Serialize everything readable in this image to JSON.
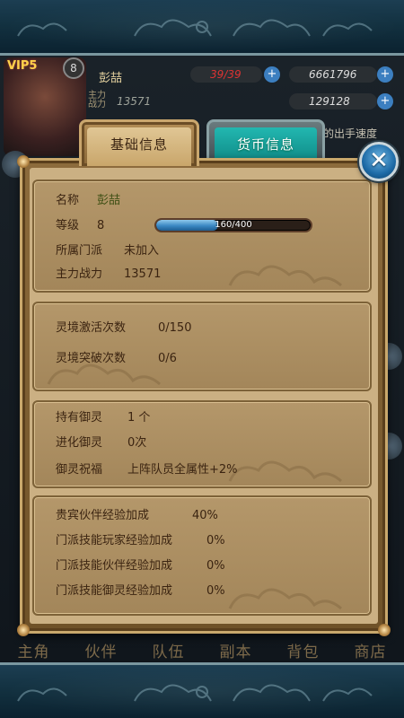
{
  "background": {
    "vip_label": "VIP5",
    "level": "8",
    "player_name": "彭喆",
    "stamina": "39/39",
    "coins": "6661796",
    "power_label": "主力战力",
    "power_value": "13571",
    "gems": "129128",
    "speed_text": "的出手速度",
    "bottom_nav": [
      "主角",
      "伙伴",
      "队伍",
      "副本",
      "背包",
      "商店"
    ]
  },
  "tabs": {
    "basic": "基础信息",
    "currency": "货币信息"
  },
  "close_label": "✕",
  "basic_info": {
    "name_label": "名称",
    "name_value": "彭喆",
    "level_label": "等级",
    "level_value": "8",
    "exp_text": "160/400",
    "exp_progress": 0.4,
    "sect_label": "所属门派",
    "sect_value": "未加入",
    "power_label": "主力战力",
    "power_value": "13571"
  },
  "spirit_realm": {
    "activate_label": "灵境激活次数",
    "activate_value": "0/150",
    "breakthrough_label": "灵境突破次数",
    "breakthrough_value": "0/6"
  },
  "spirit_info": {
    "owned_label": "持有御灵",
    "owned_value": "1 个",
    "evolved_label": "进化御灵",
    "evolved_value": "0次",
    "blessing_label": "御灵祝福",
    "blessing_value": "上阵队员全属性+2%"
  },
  "exp_bonus": {
    "vip_partner_label": "贵宾伙伴经验加成",
    "vip_partner_value": "40%",
    "sect_player_label": "门派技能玩家经验加成",
    "sect_player_value": "0%",
    "sect_partner_label": "门派技能伙伴经验加成",
    "sect_partner_value": "0%",
    "sect_spirit_label": "门派技能御灵经验加成",
    "sect_spirit_value": "0%"
  }
}
